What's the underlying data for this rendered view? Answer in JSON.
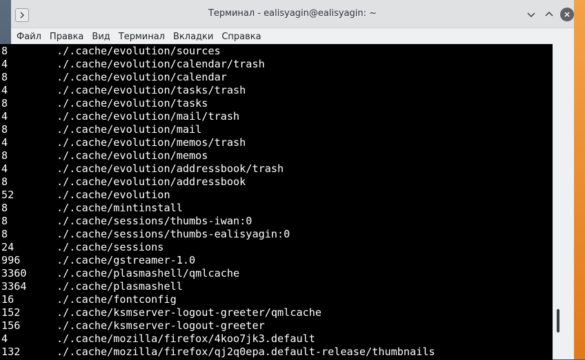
{
  "window": {
    "title": "Терминал - ealisyagin@ealisyagin: ~"
  },
  "menubar": [
    "Файл",
    "Правка",
    "Вид",
    "Терминал",
    "Вкладки",
    "Справка"
  ],
  "terminal": {
    "lines": [
      {
        "size": "8",
        "path": "./.cache/evolution/sources"
      },
      {
        "size": "4",
        "path": "./.cache/evolution/calendar/trash"
      },
      {
        "size": "8",
        "path": "./.cache/evolution/calendar"
      },
      {
        "size": "4",
        "path": "./.cache/evolution/tasks/trash"
      },
      {
        "size": "8",
        "path": "./.cache/evolution/tasks"
      },
      {
        "size": "4",
        "path": "./.cache/evolution/mail/trash"
      },
      {
        "size": "8",
        "path": "./.cache/evolution/mail"
      },
      {
        "size": "4",
        "path": "./.cache/evolution/memos/trash"
      },
      {
        "size": "8",
        "path": "./.cache/evolution/memos"
      },
      {
        "size": "4",
        "path": "./.cache/evolution/addressbook/trash"
      },
      {
        "size": "8",
        "path": "./.cache/evolution/addressbook"
      },
      {
        "size": "52",
        "path": "./.cache/evolution"
      },
      {
        "size": "8",
        "path": "./.cache/mintinstall"
      },
      {
        "size": "8",
        "path": "./.cache/sessions/thumbs-iwan:0"
      },
      {
        "size": "8",
        "path": "./.cache/sessions/thumbs-ealisyagin:0"
      },
      {
        "size": "24",
        "path": "./.cache/sessions"
      },
      {
        "size": "996",
        "path": "./.cache/gstreamer-1.0"
      },
      {
        "size": "3360",
        "path": "./.cache/plasmashell/qmlcache"
      },
      {
        "size": "3364",
        "path": "./.cache/plasmashell"
      },
      {
        "size": "16",
        "path": "./.cache/fontconfig"
      },
      {
        "size": "152",
        "path": "./.cache/ksmserver-logout-greeter/qmlcache"
      },
      {
        "size": "156",
        "path": "./.cache/ksmserver-logout-greeter"
      },
      {
        "size": "4",
        "path": "./.cache/mozilla/firefox/4koo7jk3.default"
      },
      {
        "size": "132",
        "path": "./.cache/mozilla/firefox/qj2q0epa.default-release/thumbnails"
      }
    ]
  },
  "icons": {
    "menu": "chevron-right-icon",
    "minimize": "chevron-down-icon",
    "maximize": "chevron-up-icon",
    "close": "close-icon"
  },
  "colors": {
    "terminal_bg": "#000000",
    "terminal_fg": "#ffffff",
    "titlebar_bg": "#dfe1e3",
    "menubar_bg": "#eff0f1"
  }
}
